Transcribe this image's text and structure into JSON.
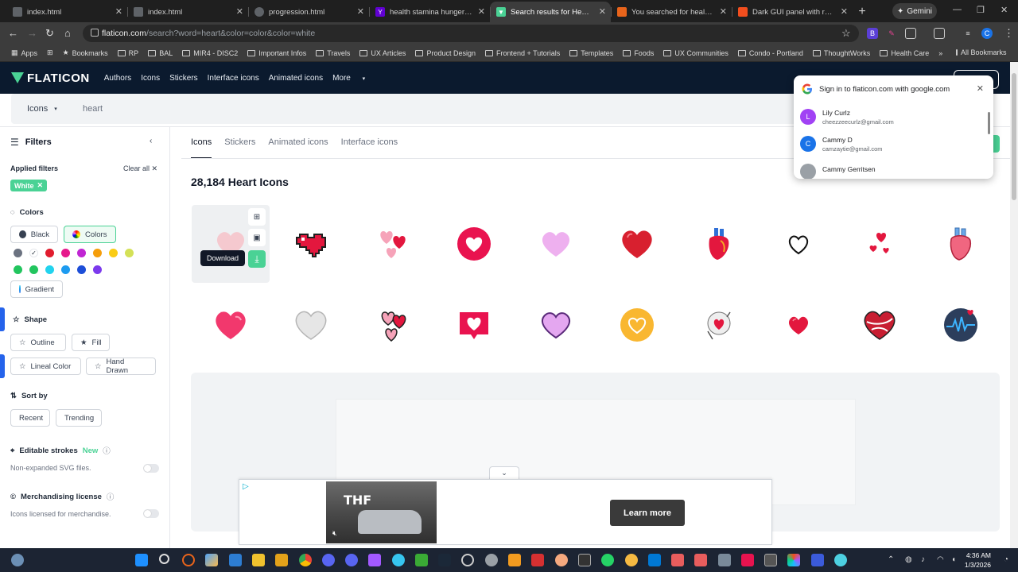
{
  "browser": {
    "tabs": [
      {
        "title": "index.html",
        "fav_color": "#5f6368",
        "active": false
      },
      {
        "title": "index.html",
        "fav_color": "#5f6368",
        "active": false
      },
      {
        "title": "progression.html",
        "fav_color": "#5f6368",
        "active": false
      },
      {
        "title": "health stamina hunger thirst",
        "fav_color": "#6001d2",
        "active": false
      },
      {
        "title": "Search results for Heart - Fla",
        "fav_color": "#4ad295",
        "active": true
      },
      {
        "title": "You searched for health - Cra",
        "fav_color": "#e8641b",
        "active": false
      },
      {
        "title": "Dark GUI panel with red HEA",
        "fav_color": "#f24e1e",
        "active": false
      }
    ],
    "new_tab": "+",
    "gemini_label": "Gemini",
    "url_domain": "flaticon.com",
    "url_path": "/search?word=heart&color=color&color=white",
    "bookmarks": [
      "Apps",
      "Bookmarks",
      "RP",
      "BAL",
      "MIR4 - DISC2",
      "Important Infos",
      "Travels",
      "UX Articles",
      "Product Design",
      "Frontend + Tutorials",
      "Templates",
      "Foods",
      "UX Communities",
      "Condo - Portland",
      "ThoughtWorks",
      "Health Care"
    ],
    "bookmarks_overflow": "»",
    "all_bookmarks": "All Bookmarks"
  },
  "site": {
    "logo_text": "FLATICON",
    "nav": [
      "Authors",
      "Icons",
      "Stickers",
      "Interface icons",
      "Animated icons",
      "More"
    ],
    "search_type": "Icons",
    "search_value": "heart"
  },
  "sidebar": {
    "title": "Filters",
    "applied_label": "Applied filters",
    "clear_all": "Clear all",
    "applied_chip": "White",
    "colors_title": "Colors",
    "black_label": "Black",
    "colors_label": "Colors",
    "gradient_label": "Gradient",
    "swatches": [
      "#6b7280",
      "#ffffff",
      "#e11d2e",
      "#e6198c",
      "#c026d3",
      "#f59e0b",
      "#facc15",
      "#d4e157",
      "#22c55e",
      "#22c55e",
      "#22d3ee",
      "#1d9bf0",
      "#1d4ed8",
      "#7c3aed"
    ],
    "shape_title": "Shape",
    "outline_label": "Outline",
    "fill_label": "Fill",
    "lineal_label": "Lineal Color",
    "hand_label": "Hand Drawn",
    "sort_title": "Sort by",
    "recent_label": "Recent",
    "trending_label": "Trending",
    "editable_title": "Editable strokes",
    "editable_new": "New",
    "editable_desc": "Non-expanded SVG files.",
    "merch_title": "Merchandising license",
    "merch_desc": "Icons licensed for merchandise."
  },
  "main": {
    "tabs": [
      "Icons",
      "Stickers",
      "Animated icons",
      "Interface icons"
    ],
    "result_title": "28,184 Heart Icons",
    "tooltip": "Download",
    "icons_row1": [
      "pale-heart",
      "pixel-heart",
      "multi-hearts",
      "heart-circle",
      "lilac-heart",
      "red-heart",
      "anatomical-heart",
      "outline-heart",
      "small-hearts",
      "anatomical-heart-2"
    ],
    "icons_row2": [
      "sparkle-heart",
      "gray-heart",
      "outlined-hearts",
      "heart-bubble",
      "purple-heart",
      "gold-heart-circle",
      "heart-in-hand",
      "small-red-heart",
      "heart-ball",
      "heart-pulse-circle"
    ],
    "ad_cta": "Learn more",
    "ad_video_text": "THF"
  },
  "google_popup": {
    "title": "Sign in to flaticon.com with google.com",
    "accounts": [
      {
        "initial": "L",
        "name": "Lily Curlz",
        "email": "cheezzeecurlz@gmail.com",
        "color": "#a142f4"
      },
      {
        "initial": "C",
        "name": "Cammy D",
        "email": "camzaytie@gmail.com",
        "color": "#1a73e8"
      },
      {
        "initial": "",
        "name": "Cammy Gerritsen",
        "email": "",
        "color": "#9aa0a6"
      }
    ]
  },
  "taskbar": {
    "time": "4:36 AM",
    "date": "1/3/2026"
  }
}
